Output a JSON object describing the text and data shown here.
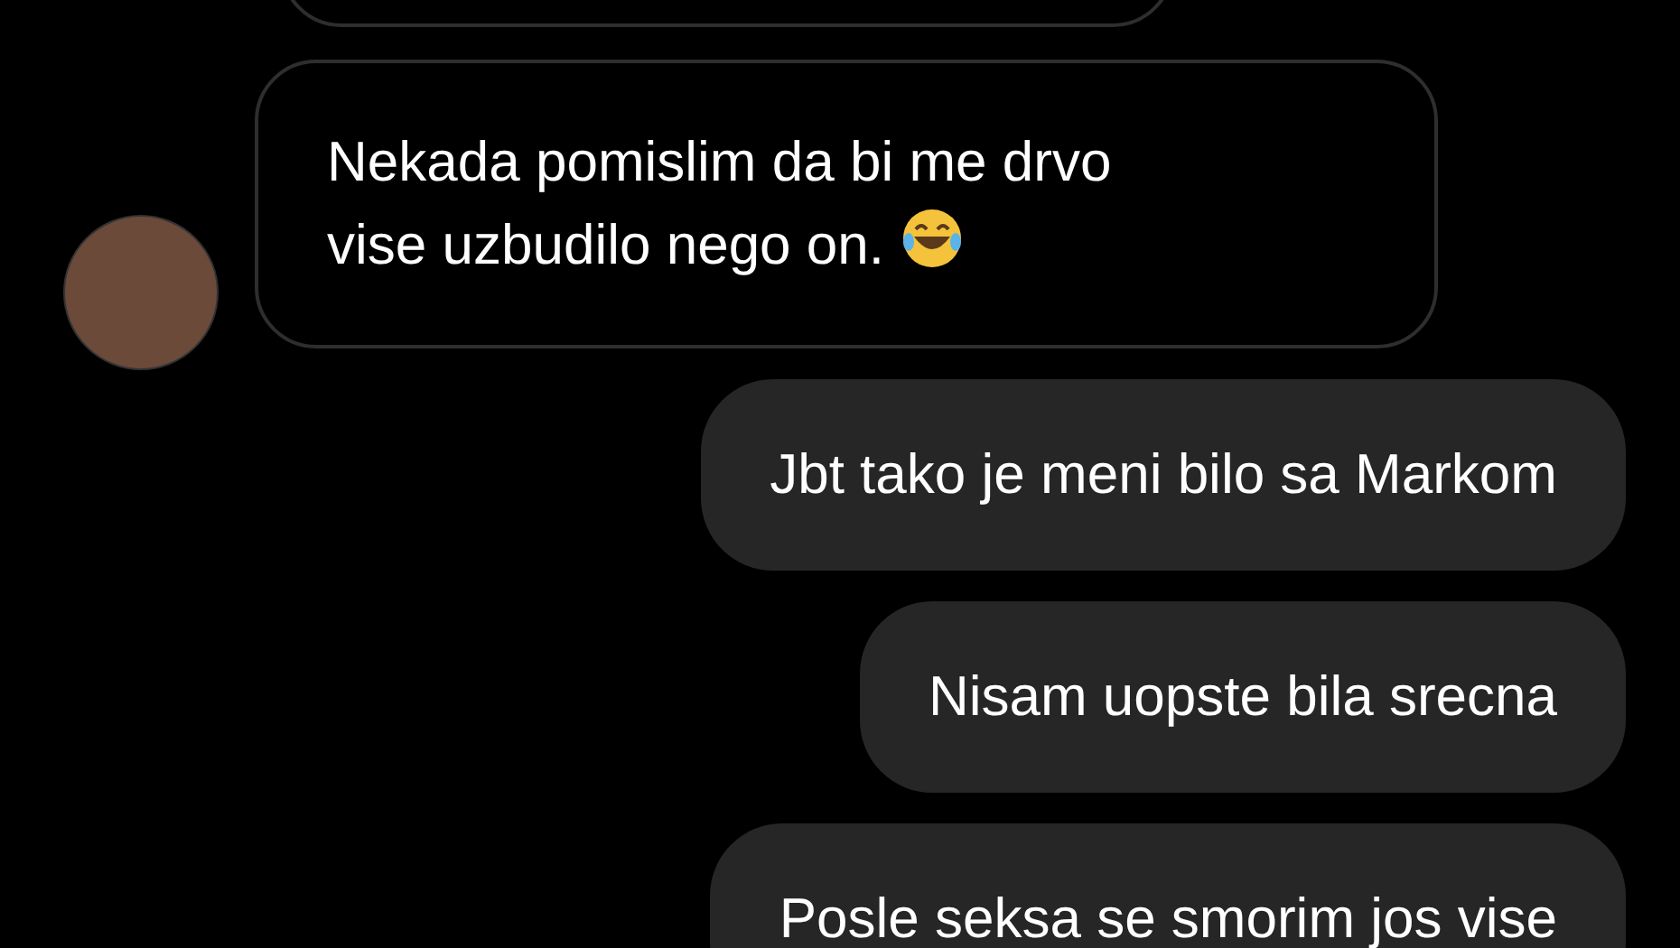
{
  "messages": [
    {
      "kind": "received"
    },
    {
      "kind": "received",
      "lines": [
        "Nekada pomislim da bi me drvo",
        "vise uzbudilo nego on."
      ],
      "laughing_emoji": true,
      "avatar": true
    },
    {
      "kind": "sent",
      "lines": [
        "Jbt tako je meni bilo sa Markom"
      ]
    },
    {
      "kind": "sent",
      "lines": [
        "Nisam uopste bila srecna"
      ]
    },
    {
      "kind": "sent",
      "lines": [
        "Posle seksa se smorim jos vise"
      ]
    }
  ]
}
